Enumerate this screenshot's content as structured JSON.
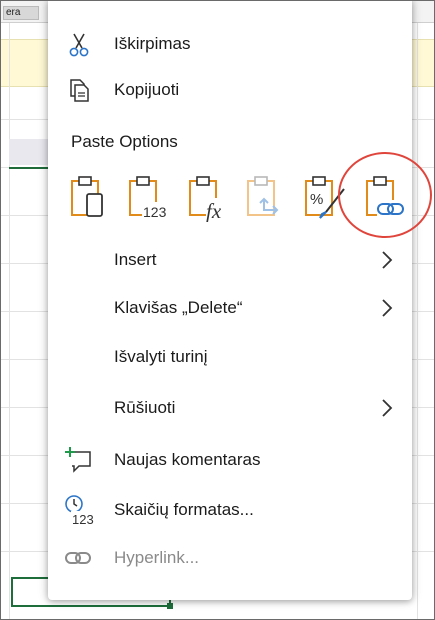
{
  "sheet": {
    "tab_label": "era"
  },
  "menu": {
    "top_items": [
      {
        "label": "Iškirpimas",
        "icon": "scissors-icon"
      },
      {
        "label": "Kopijuoti",
        "icon": "copy-icon"
      }
    ],
    "paste_options_title": "Paste Options",
    "paste_options": [
      {
        "name": "paste",
        "icon": "paste-icon"
      },
      {
        "name": "paste-values",
        "icon": "paste-values-icon",
        "badge": "123"
      },
      {
        "name": "paste-formulas",
        "icon": "paste-formulas-icon",
        "badge": "fx"
      },
      {
        "name": "paste-transpose",
        "icon": "paste-transpose-icon",
        "disabled": true
      },
      {
        "name": "paste-formatting",
        "icon": "paste-formatting-icon"
      },
      {
        "name": "paste-link",
        "icon": "paste-link-icon",
        "highlighted": true
      }
    ],
    "items": [
      {
        "label": "Insert",
        "submenu": true
      },
      {
        "label": "Klavišas „Delete“",
        "submenu": true
      },
      {
        "label": "Išvalyti turinį",
        "submenu": false
      },
      {
        "label": "Rūšiuoti",
        "submenu": true
      },
      {
        "label": "Naujas komentaras",
        "icon": "new-comment-icon"
      },
      {
        "label": "Skaičių formatas...",
        "icon": "number-format-icon",
        "badge": "123"
      },
      {
        "label": "Hyperlink...",
        "icon": "link-icon",
        "disabled": true
      }
    ]
  },
  "colors": {
    "accent_orange": "#e08b1a",
    "icon_blue": "#2b74c8",
    "highlight_red": "#e0453c",
    "excel_green": "#1e6e3b"
  }
}
